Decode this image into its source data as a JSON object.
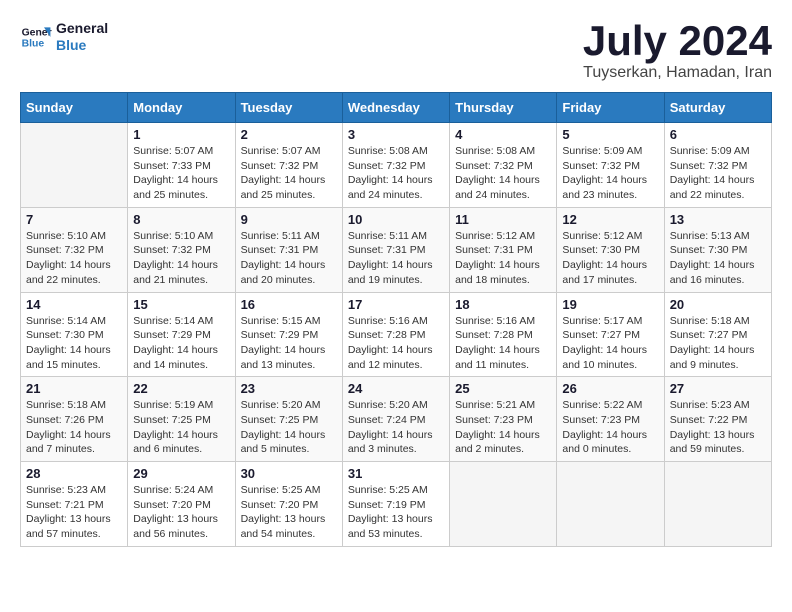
{
  "header": {
    "logo_line1": "General",
    "logo_line2": "Blue",
    "month_year": "July 2024",
    "location": "Tuyserkan, Hamadan, Iran"
  },
  "days_of_week": [
    "Sunday",
    "Monday",
    "Tuesday",
    "Wednesday",
    "Thursday",
    "Friday",
    "Saturday"
  ],
  "weeks": [
    [
      {
        "day": "",
        "info": ""
      },
      {
        "day": "1",
        "info": "Sunrise: 5:07 AM\nSunset: 7:33 PM\nDaylight: 14 hours\nand 25 minutes."
      },
      {
        "day": "2",
        "info": "Sunrise: 5:07 AM\nSunset: 7:32 PM\nDaylight: 14 hours\nand 25 minutes."
      },
      {
        "day": "3",
        "info": "Sunrise: 5:08 AM\nSunset: 7:32 PM\nDaylight: 14 hours\nand 24 minutes."
      },
      {
        "day": "4",
        "info": "Sunrise: 5:08 AM\nSunset: 7:32 PM\nDaylight: 14 hours\nand 24 minutes."
      },
      {
        "day": "5",
        "info": "Sunrise: 5:09 AM\nSunset: 7:32 PM\nDaylight: 14 hours\nand 23 minutes."
      },
      {
        "day": "6",
        "info": "Sunrise: 5:09 AM\nSunset: 7:32 PM\nDaylight: 14 hours\nand 22 minutes."
      }
    ],
    [
      {
        "day": "7",
        "info": "Sunrise: 5:10 AM\nSunset: 7:32 PM\nDaylight: 14 hours\nand 22 minutes."
      },
      {
        "day": "8",
        "info": "Sunrise: 5:10 AM\nSunset: 7:32 PM\nDaylight: 14 hours\nand 21 minutes."
      },
      {
        "day": "9",
        "info": "Sunrise: 5:11 AM\nSunset: 7:31 PM\nDaylight: 14 hours\nand 20 minutes."
      },
      {
        "day": "10",
        "info": "Sunrise: 5:11 AM\nSunset: 7:31 PM\nDaylight: 14 hours\nand 19 minutes."
      },
      {
        "day": "11",
        "info": "Sunrise: 5:12 AM\nSunset: 7:31 PM\nDaylight: 14 hours\nand 18 minutes."
      },
      {
        "day": "12",
        "info": "Sunrise: 5:12 AM\nSunset: 7:30 PM\nDaylight: 14 hours\nand 17 minutes."
      },
      {
        "day": "13",
        "info": "Sunrise: 5:13 AM\nSunset: 7:30 PM\nDaylight: 14 hours\nand 16 minutes."
      }
    ],
    [
      {
        "day": "14",
        "info": "Sunrise: 5:14 AM\nSunset: 7:30 PM\nDaylight: 14 hours\nand 15 minutes."
      },
      {
        "day": "15",
        "info": "Sunrise: 5:14 AM\nSunset: 7:29 PM\nDaylight: 14 hours\nand 14 minutes."
      },
      {
        "day": "16",
        "info": "Sunrise: 5:15 AM\nSunset: 7:29 PM\nDaylight: 14 hours\nand 13 minutes."
      },
      {
        "day": "17",
        "info": "Sunrise: 5:16 AM\nSunset: 7:28 PM\nDaylight: 14 hours\nand 12 minutes."
      },
      {
        "day": "18",
        "info": "Sunrise: 5:16 AM\nSunset: 7:28 PM\nDaylight: 14 hours\nand 11 minutes."
      },
      {
        "day": "19",
        "info": "Sunrise: 5:17 AM\nSunset: 7:27 PM\nDaylight: 14 hours\nand 10 minutes."
      },
      {
        "day": "20",
        "info": "Sunrise: 5:18 AM\nSunset: 7:27 PM\nDaylight: 14 hours\nand 9 minutes."
      }
    ],
    [
      {
        "day": "21",
        "info": "Sunrise: 5:18 AM\nSunset: 7:26 PM\nDaylight: 14 hours\nand 7 minutes."
      },
      {
        "day": "22",
        "info": "Sunrise: 5:19 AM\nSunset: 7:25 PM\nDaylight: 14 hours\nand 6 minutes."
      },
      {
        "day": "23",
        "info": "Sunrise: 5:20 AM\nSunset: 7:25 PM\nDaylight: 14 hours\nand 5 minutes."
      },
      {
        "day": "24",
        "info": "Sunrise: 5:20 AM\nSunset: 7:24 PM\nDaylight: 14 hours\nand 3 minutes."
      },
      {
        "day": "25",
        "info": "Sunrise: 5:21 AM\nSunset: 7:23 PM\nDaylight: 14 hours\nand 2 minutes."
      },
      {
        "day": "26",
        "info": "Sunrise: 5:22 AM\nSunset: 7:23 PM\nDaylight: 14 hours\nand 0 minutes."
      },
      {
        "day": "27",
        "info": "Sunrise: 5:23 AM\nSunset: 7:22 PM\nDaylight: 13 hours\nand 59 minutes."
      }
    ],
    [
      {
        "day": "28",
        "info": "Sunrise: 5:23 AM\nSunset: 7:21 PM\nDaylight: 13 hours\nand 57 minutes."
      },
      {
        "day": "29",
        "info": "Sunrise: 5:24 AM\nSunset: 7:20 PM\nDaylight: 13 hours\nand 56 minutes."
      },
      {
        "day": "30",
        "info": "Sunrise: 5:25 AM\nSunset: 7:20 PM\nDaylight: 13 hours\nand 54 minutes."
      },
      {
        "day": "31",
        "info": "Sunrise: 5:25 AM\nSunset: 7:19 PM\nDaylight: 13 hours\nand 53 minutes."
      },
      {
        "day": "",
        "info": ""
      },
      {
        "day": "",
        "info": ""
      },
      {
        "day": "",
        "info": ""
      }
    ]
  ]
}
